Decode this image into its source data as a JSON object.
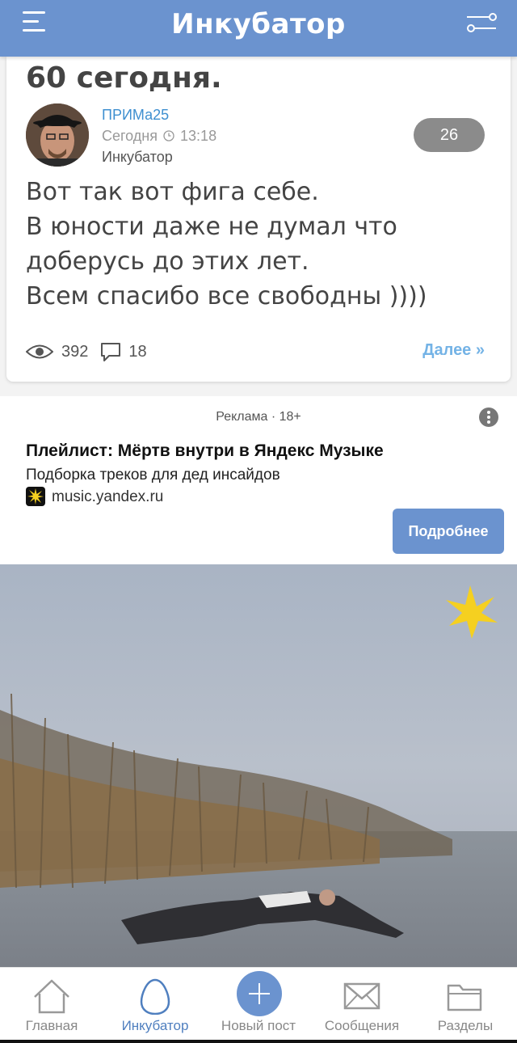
{
  "header": {
    "title": "Инкубатор"
  },
  "post": {
    "title": "60 сегодня.",
    "author": "ПРИМа25",
    "date_label": "Сегодня",
    "time": "13:18",
    "section": "Инкубатор",
    "rating": "26",
    "text_lines": [
      "Вот так вот фига себе.",
      "В юности даже не думал что",
      "доберусь до этих лет.",
      "Всем спасибо все свободны ))))"
    ],
    "views": "392",
    "comments": "18",
    "more_label": "Далее »"
  },
  "ad": {
    "label": "Реклама · 18+",
    "title": "Плейлист: Мёртв внутри в Яндекс Музыке",
    "description": "Подборка треков для дед инсайдов",
    "domain": "music.yandex.ru",
    "button_label": "Подробнее"
  },
  "bottom_nav": {
    "items": [
      {
        "label": "Главная",
        "icon": "home-icon"
      },
      {
        "label": "Инкубатор",
        "icon": "egg-icon"
      },
      {
        "label": "Новый пост",
        "icon": "plus-icon"
      },
      {
        "label": "Сообщения",
        "icon": "envelope-icon"
      },
      {
        "label": "Разделы",
        "icon": "folder-icon"
      }
    ]
  },
  "colors": {
    "header": "#6b93cf",
    "accent": "#6b93cf",
    "author_link": "#3e8fd0",
    "more_link": "#74b3e6",
    "rating_badge": "#8b8b8b"
  }
}
